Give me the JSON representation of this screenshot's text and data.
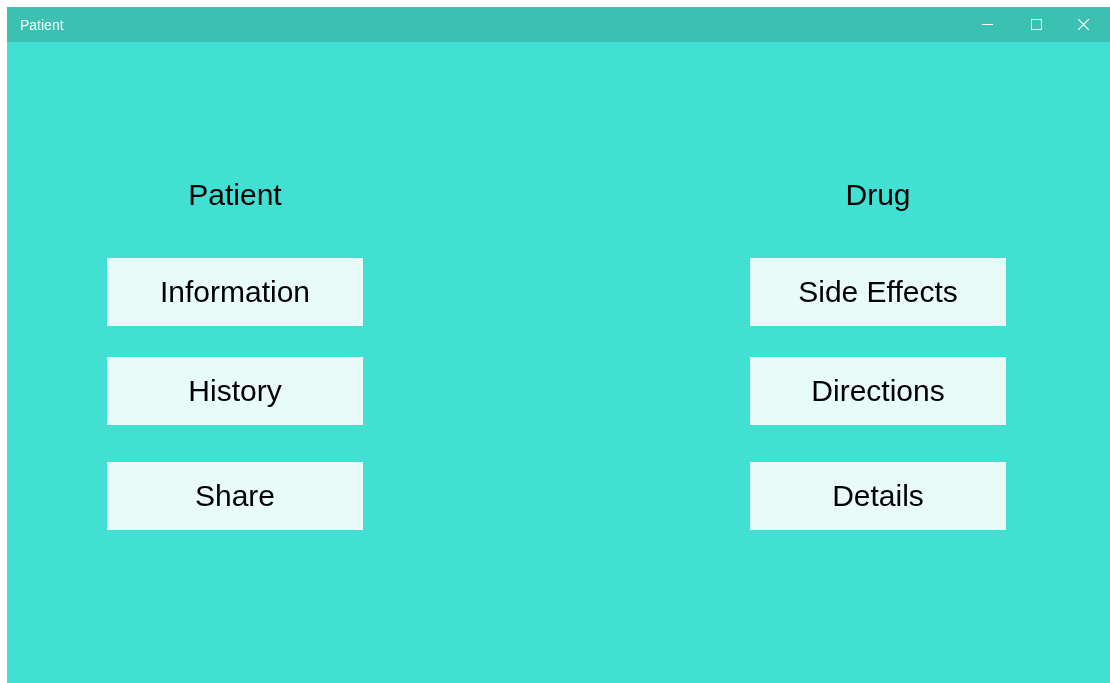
{
  "window": {
    "title": "Patient"
  },
  "sections": [
    {
      "heading": "Patient",
      "buttons": [
        "Information",
        "History",
        "Share"
      ]
    },
    {
      "heading": "Drug",
      "buttons": [
        "Side Effects",
        "Directions",
        "Details"
      ]
    }
  ]
}
